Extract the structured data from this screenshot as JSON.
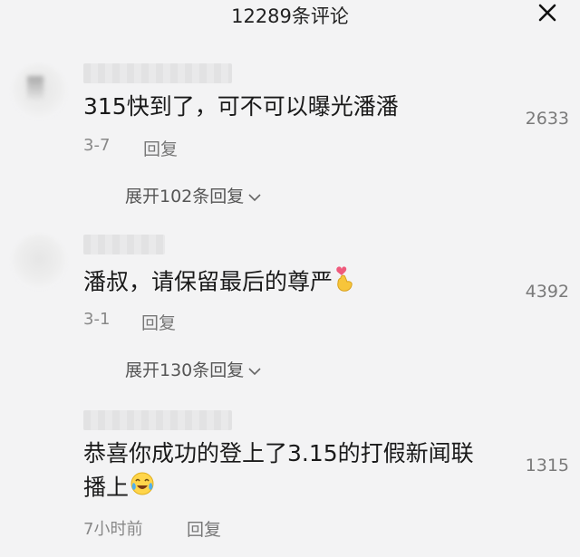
{
  "header": {
    "title": "12289条评论",
    "close_icon": "close-icon"
  },
  "comments": [
    {
      "text": "315快到了，可不可以曝光潘潘",
      "likes": "2633",
      "date": "3-7",
      "reply_label": "回复",
      "expand_label": "展开102条回复"
    },
    {
      "text": "潘叔，请保留最后的尊严",
      "emoji": "finger-heart-icon",
      "likes": "4392",
      "date": "3-1",
      "reply_label": "回复",
      "expand_label": "展开130条回复"
    },
    {
      "text_line1": "恭喜你成功的登上了3.15的打假新闻联",
      "text_line2": "播上",
      "emoji": "crying-laughing-icon",
      "likes": "1315",
      "date": "7小时前",
      "reply_label": "回复"
    }
  ]
}
